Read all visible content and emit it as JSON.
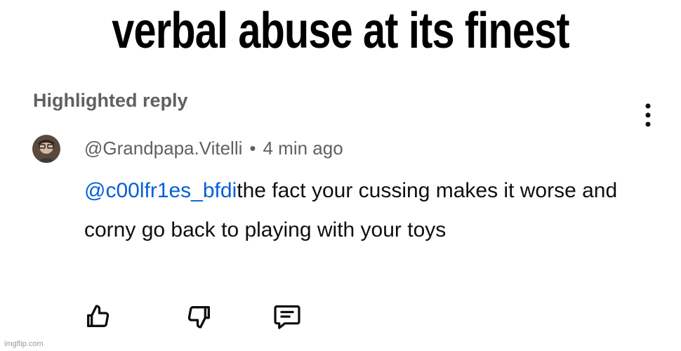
{
  "caption": "verbal abuse at its finest",
  "comment_card": {
    "header_label": "Highlighted reply",
    "menu_icon": "more-vertical-icon",
    "author": "@Grandpapa.Vitelli",
    "separator": "•",
    "time": "4 min ago",
    "mention": "@c00lfr1es_bfdi",
    "text": "the fact your cussing makes it worse and corny go back to playing with your toys",
    "mention_color": "#065fd4",
    "actions": {
      "like_icon": "thumbs-up-icon",
      "dislike_icon": "thumbs-down-icon",
      "reply_icon": "reply-comment-icon"
    }
  },
  "watermark": "imgflip.com"
}
